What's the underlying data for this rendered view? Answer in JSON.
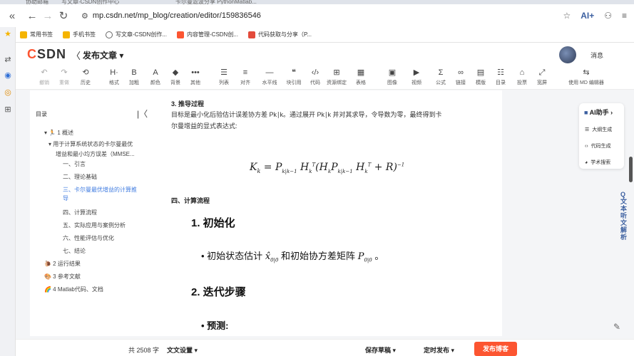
{
  "browser": {
    "tabs": [
      "协助邮箱",
      "写文章-CSDN创作中心",
      "卡尔曼滤波分享 PythonMatlab..."
    ],
    "address": "mp.csdn.net/mp_blog/creation/editor/159836546",
    "right_ai": "AI+",
    "bookmarks": [
      "常用书签",
      "手机书签",
      "写文章-CSDN创作...",
      "内容管理-CSDN创...",
      "代码获取与分享（P..."
    ],
    "bookmark_colors": [
      "#f5b400",
      "#f5b400",
      "#666666",
      "#fc5531",
      "#e34b3b"
    ]
  },
  "header": {
    "logo_c": "C",
    "logo_rest": "SDN",
    "back": "〈",
    "title": "发布文章 ▾",
    "messages": "消息"
  },
  "toolbar": [
    {
      "icon": "↶",
      "label": "撤销",
      "name": "undo",
      "disabled": true
    },
    {
      "icon": "↷",
      "label": "重做",
      "name": "redo",
      "disabled": true
    },
    {
      "icon": "⟲",
      "label": "历史",
      "name": "history"
    },
    {
      "icon": "H·",
      "label": "格式",
      "name": "format"
    },
    {
      "icon": "B",
      "label": "加粗",
      "name": "bold"
    },
    {
      "icon": "A",
      "label": "颜色",
      "name": "color"
    },
    {
      "icon": "◆",
      "label": "背景",
      "name": "background"
    },
    {
      "icon": "•••",
      "label": "其他",
      "name": "other"
    },
    {
      "icon": "☰",
      "label": "列表",
      "name": "list"
    },
    {
      "icon": "≡",
      "label": "对齐",
      "name": "align"
    },
    {
      "icon": "—",
      "label": "水平线",
      "name": "hr"
    },
    {
      "icon": "❝",
      "label": "块引用",
      "name": "quote"
    },
    {
      "icon": "‹/›",
      "label": "代码",
      "name": "code"
    },
    {
      "icon": "⊞",
      "label": "资源绑定",
      "name": "resource"
    },
    {
      "icon": "▦",
      "label": "表格",
      "name": "table"
    },
    {
      "icon": "▣",
      "label": "图像",
      "name": "image"
    },
    {
      "icon": "▶",
      "label": "视频",
      "name": "video"
    },
    {
      "icon": "Σ",
      "label": "公式",
      "name": "formula"
    },
    {
      "icon": "∞",
      "label": "链接",
      "name": "link"
    },
    {
      "icon": "▤",
      "label": "模版",
      "name": "template"
    },
    {
      "icon": "☷",
      "label": "目录",
      "name": "toc"
    },
    {
      "icon": "⌂",
      "label": "投票",
      "name": "vote"
    },
    {
      "icon": "⤢",
      "label": "宽屏",
      "name": "wide"
    },
    {
      "icon": "⇆",
      "label": "使用 MD 编辑器",
      "name": "md"
    }
  ],
  "toc": {
    "title": "目录",
    "items": [
      {
        "text": "▾ 🏃 1 概述",
        "level": 0
      },
      {
        "text": "▾ 用于计算系统状态的卡尔曼最优",
        "level": 1
      },
      {
        "text": "增益和最小均方误差（MMSE...",
        "level": 2
      },
      {
        "text": "一、引言",
        "level": 3
      },
      {
        "text": "二、理论基础",
        "level": 3
      },
      {
        "text": "三、卡尔曼最优增益的计算推",
        "level": 3,
        "active": true
      },
      {
        "text": "导",
        "level": 3,
        "active": true
      },
      {
        "text": "四、计算流程",
        "level": 3
      },
      {
        "text": "五、实际应用与案例分析",
        "level": 3
      },
      {
        "text": "六、性能评估与优化",
        "level": 3
      },
      {
        "text": "七、结论",
        "level": 3
      },
      {
        "text": "🐌 2 运行结果",
        "level": 0
      },
      {
        "text": "🎨 3 参考文献",
        "level": 0
      },
      {
        "text": "🌈 4 Matlab代码、文档",
        "level": 0
      }
    ]
  },
  "article": {
    "section3": "3. 推导过程",
    "p1": "目标是最小化后验估计误差协方差 Pk∣k。通过展开 Pk∣k 并对其求导，令导数为零，最终得到卡",
    "p2": "尔曼增益的显式表达式:",
    "formula": "K_k = P_{k|k-1} H_k^T (H_k P_{k|k-1} H_k^T + R)^{-1}",
    "section4": "四、计算流程",
    "h_init": "1. 初始化",
    "init_bullet_pre": "初始状态估计",
    "init_bullet_mid": "和初始协方差矩阵",
    "h_iter": "2. 迭代步骤",
    "predict": "预测:"
  },
  "ai": {
    "head": "AI助手 ›",
    "items": [
      "大纲生成",
      "代码生成",
      "学术搜索"
    ]
  },
  "side_vertical": "Q 文本 听文解析",
  "bottom": {
    "count": "共 2508 字",
    "docset": "文文设置 ▾",
    "save": "保存草稿 ▾",
    "timed": "定时发布 ▾",
    "publish": "发布博客"
  }
}
